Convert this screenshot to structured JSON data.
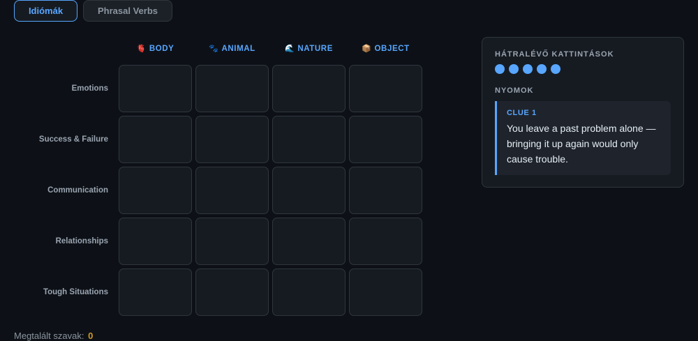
{
  "tabs": [
    {
      "label": "Idiómák",
      "active": true
    },
    {
      "label": "Phrasal Verbs",
      "active": false
    }
  ],
  "columns": [
    {
      "emoji": "🫀",
      "label": "BODY"
    },
    {
      "emoji": "🐾",
      "label": "ANIMAL"
    },
    {
      "emoji": "🌊",
      "label": "NATURE"
    },
    {
      "emoji": "📦",
      "label": "OBJECT"
    }
  ],
  "rows": [
    {
      "label": "Emotions"
    },
    {
      "label": "Success & Failure"
    },
    {
      "label": "Communication"
    },
    {
      "label": "Relationships"
    },
    {
      "label": "Tough Situations"
    }
  ],
  "footer": {
    "label": "Megtalált szavak:",
    "count": "0"
  },
  "panel": {
    "clicks_title": "HÁTRALÉVŐ KATTINTÁSOK",
    "clicks_remaining": 5,
    "clues_title": "NYOMOK",
    "clues": [
      {
        "label": "CLUE 1",
        "text": "You leave a past problem alone — bringing it up again would only cause trouble."
      }
    ]
  },
  "colors": {
    "accent": "#58a6ff",
    "count": "#d29922",
    "background": "#0d1117"
  }
}
